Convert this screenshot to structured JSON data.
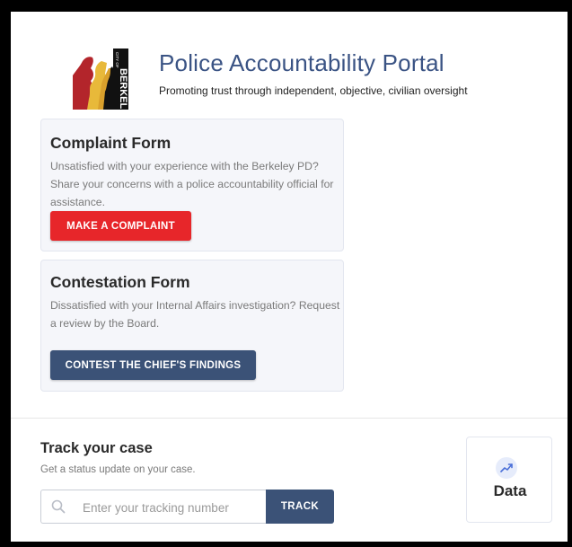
{
  "header": {
    "logo_top_text": "CITY OF",
    "logo_city": "BERKELEY",
    "title": "Police Accountability Portal",
    "subtitle": "Promoting trust through independent, objective, civilian oversight"
  },
  "complaint": {
    "title": "Complaint Form",
    "description": "Unsatisfied with your experience with the Berkeley PD? Share your concerns with a police accountability official for assistance.",
    "button_label": "MAKE A COMPLAINT"
  },
  "contestation": {
    "title": "Contestation Form",
    "description": "Dissatisfied with your Internal Affairs investigation? Request a review by the Board.",
    "button_label": "CONTEST THE CHIEF'S FINDINGS"
  },
  "track": {
    "title": "Track your case",
    "subtitle": "Get a status update on your case.",
    "input_placeholder": "Enter your tracking number",
    "input_value": "",
    "button_label": "TRACK"
  },
  "data_card": {
    "label": "Data",
    "icon": "trending-up-icon"
  },
  "colors": {
    "title_blue": "#3a5384",
    "complaint_red": "#e7262a",
    "navy": "#3b5277",
    "card_bg": "#f5f6fa"
  }
}
